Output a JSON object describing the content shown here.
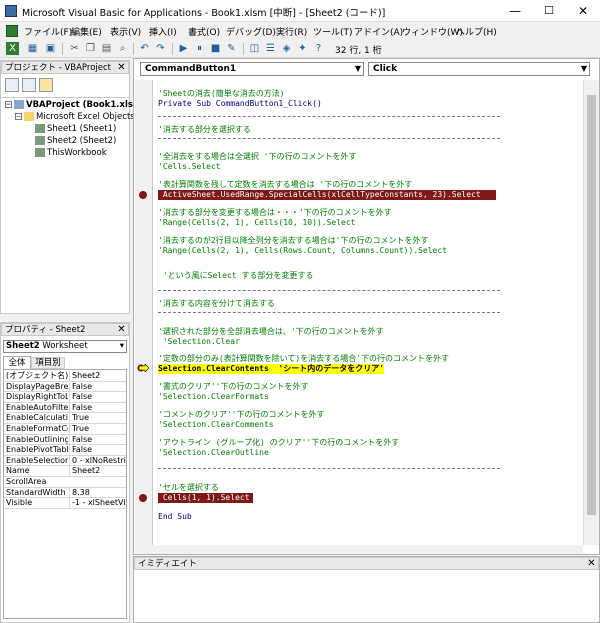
{
  "window": {
    "title": "Microsoft Visual Basic for Applications - Book1.xlsm [中断] - [Sheet2 (コード)]",
    "minimize": "—",
    "maximize": "☐",
    "close": "✕"
  },
  "menu": [
    "ファイル(F)",
    "編集(E)",
    "表示(V)",
    "挿入(I)",
    "書式(O)",
    "デバッグ(D)",
    "実行(R)",
    "ツール(T)",
    "アドイン(A)",
    "ウィンドウ(W)",
    "ヘルプ(H)"
  ],
  "toolbar": {
    "position": "32 行, 1 桁"
  },
  "project": {
    "title": "プロジェクト - VBAProject",
    "tree": [
      {
        "label": "VBAProject (Book1.xlsm)",
        "indent": 0,
        "bold": true
      },
      {
        "label": "Microsoft Excel Objects",
        "indent": 1
      },
      {
        "label": "Sheet1 (Sheet1)",
        "indent": 2
      },
      {
        "label": "Sheet2 (Sheet2)",
        "indent": 2
      },
      {
        "label": "ThisWorkbook",
        "indent": 2
      }
    ]
  },
  "properties": {
    "title": "プロパティ - Sheet2",
    "object_name": "Sheet2",
    "object_type": "Worksheet",
    "tabs": [
      "全体",
      "項目別"
    ],
    "rows": [
      {
        "name": "(オブジェクト名)",
        "value": "Sheet2"
      },
      {
        "name": "DisplayPageBreaks",
        "value": "False"
      },
      {
        "name": "DisplayRightToLeft",
        "value": "False"
      },
      {
        "name": "EnableAutoFilter",
        "value": "False"
      },
      {
        "name": "EnableCalculation",
        "value": "True"
      },
      {
        "name": "EnableFormatConditionsCalculation",
        "value": "True"
      },
      {
        "name": "EnableOutlining",
        "value": "False"
      },
      {
        "name": "EnablePivotTable",
        "value": "False"
      },
      {
        "name": "EnableSelection",
        "value": "0 - xlNoRestrictions"
      },
      {
        "name": "Name",
        "value": "Sheet2"
      },
      {
        "name": "ScrollArea",
        "value": ""
      },
      {
        "name": "StandardWidth",
        "value": "8.38"
      },
      {
        "name": "Visible",
        "value": "-1 - xlSheetVisible"
      }
    ]
  },
  "code": {
    "object_combo": "CommandButton1",
    "proc_combo": "Click",
    "lines": [
      {
        "t": "'Sheetの消去(簡単な消去の方法)",
        "c": "cm"
      },
      {
        "t": "Private Sub CommandButton1_Click()",
        "c": "kw"
      },
      {
        "t": "'消去する部分を選択する",
        "c": "cm"
      },
      {
        "t": "'全消去をする場合は全選択 '下の行のコメントを外す",
        "c": "cm"
      },
      {
        "t": "'Cells.Select",
        "c": "cm"
      },
      {
        "t": "'表計算関数を残して定数を消去する場合は '下の行のコメントを外す",
        "c": "cm"
      },
      {
        "t": " ActiveSheet.UsedRange.SpecialCells(xlCellTypeConstants, 23).Select",
        "c": "bp"
      },
      {
        "t": "'消去する部分を変更する場合は・・・'下の行のコメントを外す",
        "c": "cm"
      },
      {
        "t": "'Range(Cells(2, 1), Cells(10, 10)).Select",
        "c": "cm"
      },
      {
        "t": "'消去するのが2行目以降全列分を消去する場合は'下の行のコメントを外す",
        "c": "cm"
      },
      {
        "t": "'Range(Cells(2, 1), Cells(Rows.Count, Columns.Count)).Select",
        "c": "cm"
      },
      {
        "t": " 'という風にSelect する部分を変更する",
        "c": "cm"
      },
      {
        "t": "'消去する内容を分けて消去する",
        "c": "cm"
      },
      {
        "t": "'選択された部分を全部消去場合は、'下の行のコメントを外す",
        "c": "cm"
      },
      {
        "t": " 'Selection.Clear",
        "c": "cm"
      },
      {
        "t": "'定数の部分のみ(表計算関数を除いて)を消去する場合'下の行のコメントを外す",
        "c": "cm"
      },
      {
        "t": "Selection.ClearContents  'シート内のデータをクリア'",
        "c": "cur"
      },
      {
        "t": "'書式のクリア''下の行のコメントを外す",
        "c": "cm"
      },
      {
        "t": "'Selection.ClearFormats",
        "c": "cm"
      },
      {
        "t": "'コメントのクリア''下の行のコメントを外す",
        "c": "cm"
      },
      {
        "t": "'Selection.ClearComments",
        "c": "cm"
      },
      {
        "t": "'アウトライン (グループ化) のクリア''下の行のコメントを外す",
        "c": "cm"
      },
      {
        "t": "'Selection.ClearOutline",
        "c": "cm"
      },
      {
        "t": "'セルを選択する",
        "c": "cm"
      },
      {
        "t": " Cells(1, 1).Select",
        "c": "bp"
      },
      {
        "t": "End Sub",
        "c": "kw"
      }
    ]
  },
  "immediate": {
    "title": "イミディエイト"
  },
  "colors": {
    "comment": "#008000",
    "keyword": "#00007f",
    "breakpoint": "#7f1818",
    "current_line": "#ffff00"
  }
}
